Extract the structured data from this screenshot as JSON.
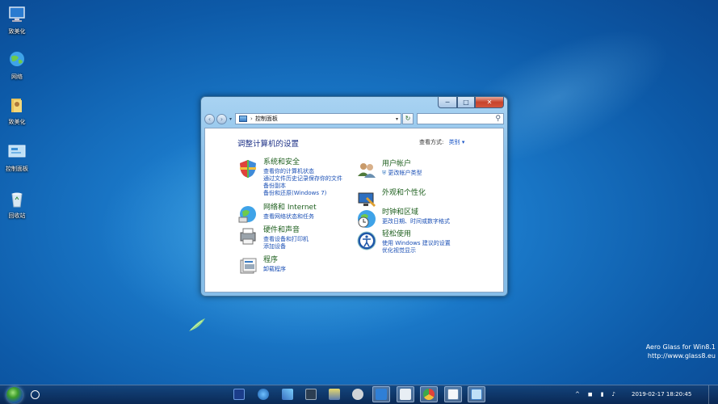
{
  "desktop": {
    "icons": [
      {
        "label": "致美化"
      },
      {
        "label": "网络"
      },
      {
        "label": "致美化"
      },
      {
        "label": "控制面板"
      },
      {
        "label": "回收站"
      }
    ]
  },
  "window": {
    "title_buttons": {
      "minimize": "─",
      "maximize": "□",
      "close": "✕"
    },
    "address": {
      "arrow": "›",
      "path": "控制面板"
    },
    "search_placeholder": "",
    "heading": "调整计算机的设置",
    "view_by_label": "查看方式:",
    "view_by_value": "类别 ▾",
    "categories": [
      {
        "title": "系统和安全",
        "links": [
          "查看你的计算机状态",
          "通过文件历史记录保存你的文件",
          "备份副本",
          "备份和还原(Windows 7)"
        ]
      },
      {
        "title": "网络和 Internet",
        "links": [
          "查看网络状态和任务"
        ]
      },
      {
        "title": "硬件和声音",
        "links": [
          "查看设备和打印机",
          "添加设备"
        ]
      },
      {
        "title": "程序",
        "links": [
          "卸载程序"
        ]
      },
      {
        "title": "用户帐户",
        "links": [
          "更改帐户类型"
        ]
      },
      {
        "title": "外观和个性化",
        "links": []
      },
      {
        "title": "时钟和区域",
        "links": [
          "更改日期、时间或数字格式"
        ]
      },
      {
        "title": "轻松使用",
        "links": [
          "使用 Windows 建议的设置",
          "优化视觉显示"
        ]
      }
    ]
  },
  "taskbar": {
    "tray_icons": [
      "^",
      "◼",
      "▮",
      "♪"
    ],
    "clock": "2019-02-17  18:20:45"
  },
  "watermark": {
    "line1": "Aero Glass for Win8.1",
    "line2": "http://www.glass8.eu"
  },
  "colors": {
    "link": "#1a4fb5",
    "category_title": "#1e5f1e",
    "heading": "#1e3287"
  }
}
